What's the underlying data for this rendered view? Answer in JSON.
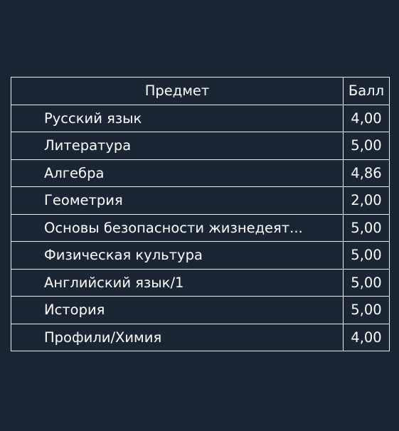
{
  "header": {
    "subject": "Предмет",
    "score": "Балл"
  },
  "rows": [
    {
      "subject": "Русский язык",
      "score": "4,00"
    },
    {
      "subject": "Литература",
      "score": "5,00"
    },
    {
      "subject": "Алгебра",
      "score": "4,86"
    },
    {
      "subject": "Геометрия",
      "score": "2,00"
    },
    {
      "subject": "Основы безопасности жизнедеят...",
      "score": "5,00"
    },
    {
      "subject": "Физическая культура",
      "score": "5,00"
    },
    {
      "subject": "Английский язык/1",
      "score": "5,00"
    },
    {
      "subject": "История",
      "score": "5,00"
    },
    {
      "subject": "Профили/Химия",
      "score": "4,00"
    }
  ]
}
